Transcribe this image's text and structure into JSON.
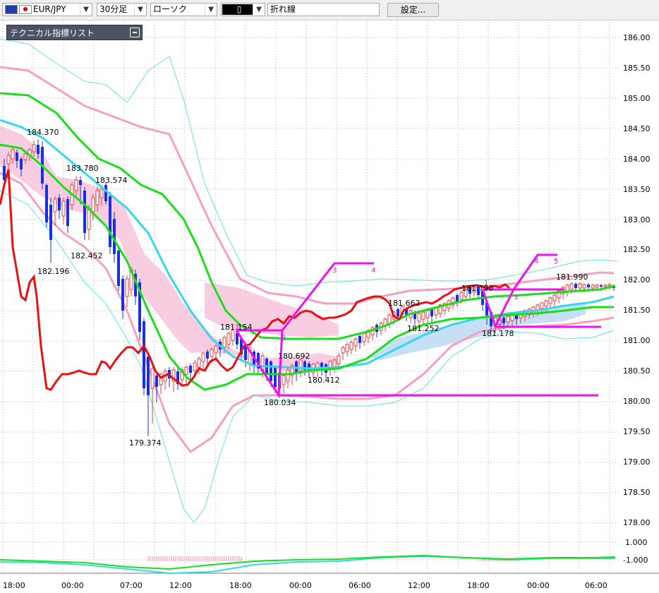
{
  "toolbar": {
    "symbol": "EUR/JPY",
    "timeframe": "30分足",
    "chart_style": "ローソク",
    "draw_tool": "折れ線",
    "settings_button": "設定..."
  },
  "indicator_panel": {
    "title": "テクニカル指標リスト"
  },
  "y_ticks": [
    "186.00",
    "185.50",
    "185.00",
    "184.50",
    "184.00",
    "183.50",
    "183.00",
    "182.50",
    "182.00",
    "181.50",
    "181.00",
    "180.50",
    "180.00",
    "179.50",
    "179.00",
    "178.50",
    "178.00"
  ],
  "sub_y_ticks": [
    "1.000",
    "-1.000"
  ],
  "x_ticks": [
    "18:00",
    "00:00",
    "07:00",
    "12:00",
    "18:00",
    "00:00",
    "06:00",
    "12:00",
    "18:00",
    "00:00",
    "06:00"
  ],
  "price_labels": [
    "184.370",
    "183.780",
    "183.574",
    "182.452",
    "182.196",
    "179.374",
    "181.154",
    "180.692",
    "180.412",
    "180.034",
    "181.662",
    "181.252",
    "181.790",
    "181.178",
    "181.990"
  ],
  "pattern_labels": [
    "1",
    "2",
    "3",
    "4",
    "1",
    "2",
    "3",
    "4",
    "5"
  ],
  "colors": {
    "grid": "#b0b0b0",
    "ma_red": "#e81010",
    "ma_green": "#18e018",
    "ma_cyan": "#35d8e8",
    "band_pink": "#f5a0c0",
    "band_cyan": "#60e0f0",
    "cloud_pink": "#f8c4dc",
    "cloud_blue": "#c0dcf4",
    "pattern_magenta": "#ee10ee",
    "candle_up": "#e04040",
    "candle_down": "#1830e0"
  }
}
